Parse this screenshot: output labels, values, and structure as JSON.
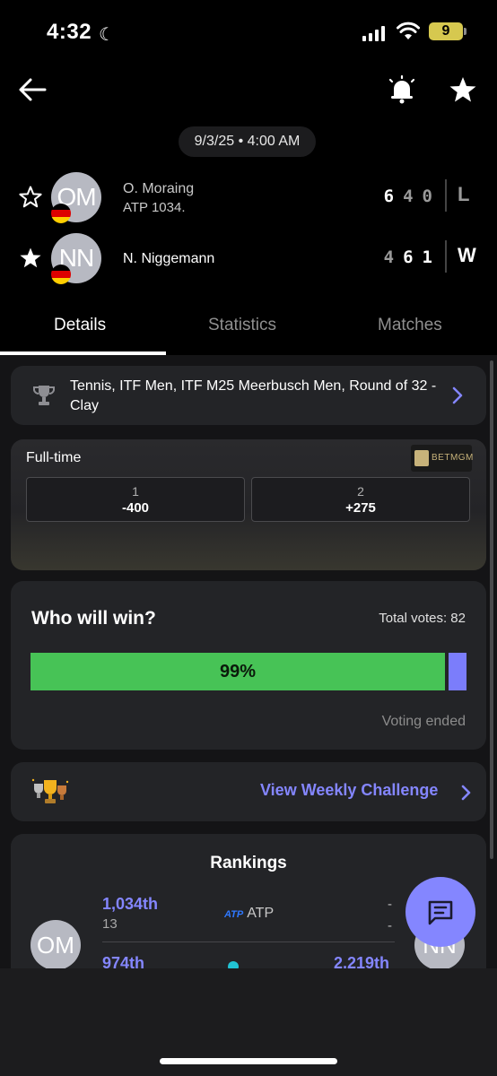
{
  "status": {
    "time": "4:32",
    "battery": "9"
  },
  "match": {
    "datetime": "9/3/25 • 4:00 AM"
  },
  "players": [
    {
      "initials": "OM",
      "name": "O. Moraing",
      "rank": "ATP 1034.",
      "scores": [
        "6",
        "4",
        "0"
      ],
      "result": "L"
    },
    {
      "initials": "NN",
      "name": "N. Niggemann",
      "rank": "",
      "scores": [
        "4",
        "6",
        "1"
      ],
      "result": "W"
    }
  ],
  "tabs": [
    "Details",
    "Statistics",
    "Matches"
  ],
  "tournament": {
    "text": "Tennis, ITF Men, ITF M25 Meerbusch Men, Round of 32 - Clay"
  },
  "odds": {
    "label": "Full-time",
    "brand": "BETMGM",
    "options": [
      {
        "n": "1",
        "v": "-400"
      },
      {
        "n": "2",
        "v": "+275"
      }
    ]
  },
  "vote": {
    "question": "Who will win?",
    "total": "Total votes: 82",
    "home_pct_label": "99%",
    "home_fraction": 0.95,
    "status": "Voting ended"
  },
  "weekly": {
    "label": "View Weekly Challenge"
  },
  "rankings": {
    "title": "Rankings",
    "p1_initials": "OM",
    "p2_initials": "NN",
    "row1": {
      "value": "1,034th",
      "sub": "13",
      "org": "ATP",
      "right_top": "-",
      "right_bottom": "-"
    },
    "row2": {
      "value": "974th",
      "right_value": "2,219th"
    }
  },
  "colors": {
    "accent": "#8486ff",
    "home_bar": "#47c356",
    "away_bar": "#7b7dfb"
  }
}
